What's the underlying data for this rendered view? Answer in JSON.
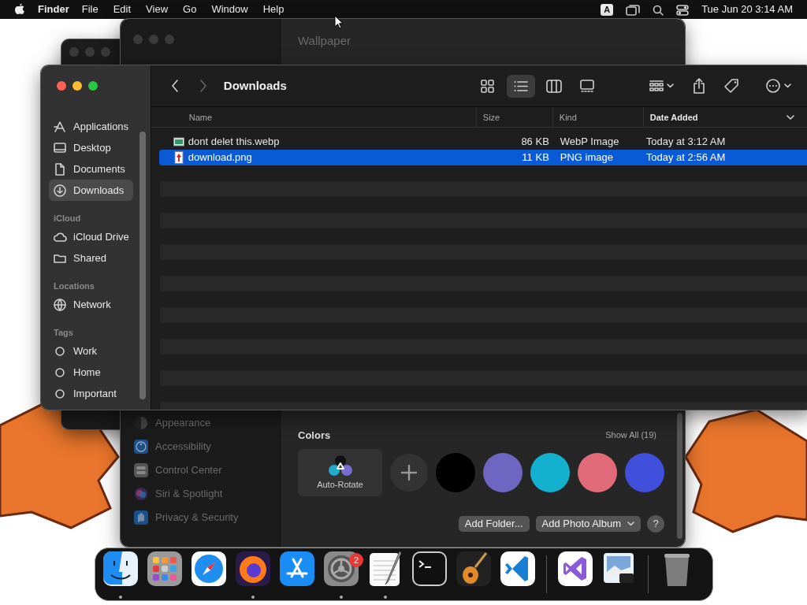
{
  "menu_bar": {
    "app_name": "Finder",
    "menus": [
      "File",
      "Edit",
      "View",
      "Go",
      "Window",
      "Help"
    ],
    "input_source": "A",
    "clock": "Tue Jun 20  3:14 AM"
  },
  "settings_window": {
    "title": "Wallpaper",
    "sidebar": [
      {
        "label": "Appearance",
        "kind": "appearance"
      },
      {
        "label": "Accessibility",
        "kind": "accessibility"
      },
      {
        "label": "Control Center",
        "kind": "control"
      },
      {
        "label": "Siri & Spotlight",
        "kind": "siri"
      },
      {
        "label": "Privacy & Security",
        "kind": "privacy"
      }
    ],
    "colors": {
      "heading": "Colors",
      "show_all": "Show All (19)",
      "auto_rotate": "Auto-Rotate",
      "swatches": [
        {
          "color": "#000000"
        },
        {
          "color": "#6e66c0"
        },
        {
          "color": "#13b0d0"
        },
        {
          "color": "#e06a78"
        },
        {
          "color": "#4050dd"
        }
      ]
    },
    "buttons": [
      {
        "label": "Add Folder...",
        "kind": "plain"
      },
      {
        "label": "Add Photo Album",
        "kind": "menu"
      }
    ],
    "help": "?"
  },
  "finder": {
    "title": "Downloads",
    "view_modes": [
      {
        "kind": "icons",
        "selected": false
      },
      {
        "kind": "list",
        "selected": true
      },
      {
        "kind": "columns",
        "selected": false
      },
      {
        "kind": "gallery",
        "selected": false
      }
    ],
    "sidebar": [
      {
        "items": [
          {
            "label": "Applications",
            "kind": "apps",
            "selected": false
          },
          {
            "label": "Desktop",
            "kind": "desktop",
            "selected": false
          },
          {
            "label": "Documents",
            "kind": "document",
            "selected": false
          },
          {
            "label": "Downloads",
            "kind": "download",
            "selected": true
          }
        ]
      },
      {
        "heading": "iCloud",
        "items": [
          {
            "label": "iCloud Drive",
            "kind": "cloud",
            "selected": false
          },
          {
            "label": "Shared",
            "kind": "shared",
            "selected": false
          }
        ]
      },
      {
        "heading": "Locations",
        "items": [
          {
            "label": "Network",
            "kind": "network",
            "selected": false
          }
        ]
      },
      {
        "heading": "Tags",
        "items": [
          {
            "label": "Work",
            "kind": "tag",
            "selected": false
          },
          {
            "label": "Home",
            "kind": "tag",
            "selected": false
          },
          {
            "label": "Important",
            "kind": "tag",
            "selected": false
          }
        ]
      }
    ],
    "columns": [
      {
        "label": "Name",
        "sorted": false
      },
      {
        "label": "Size",
        "sorted": false
      },
      {
        "label": "Kind",
        "sorted": false
      },
      {
        "label": "Date Added",
        "sorted": true
      }
    ],
    "files": [
      {
        "name": "dont delet this.webp",
        "size": "86 KB",
        "kind_label": "WebP Image",
        "date_added": "Today at 3:12 AM",
        "kind": "webp",
        "selected": false
      },
      {
        "name": "download.png",
        "size": "11 KB",
        "kind_label": "PNG image",
        "date_added": "Today at 2:56 AM",
        "kind": "png",
        "selected": true
      }
    ]
  },
  "dock": {
    "items": [
      {
        "kind": "finder",
        "running": true
      },
      {
        "kind": "launchpad",
        "running": false
      },
      {
        "kind": "safari",
        "running": false
      },
      {
        "kind": "firefox",
        "running": true
      },
      {
        "kind": "appstore",
        "running": false
      },
      {
        "kind": "settings",
        "running": true,
        "badge": "2"
      },
      {
        "kind": "textedit",
        "running": true
      },
      {
        "kind": "terminal",
        "running": false
      },
      {
        "kind": "garageband",
        "running": false
      },
      {
        "kind": "vscode",
        "running": false
      },
      {
        "kind": "separator"
      },
      {
        "kind": "visualstudio",
        "running": false
      },
      {
        "kind": "preview",
        "running": false
      },
      {
        "kind": "separator"
      },
      {
        "kind": "trash",
        "running": false
      }
    ]
  }
}
